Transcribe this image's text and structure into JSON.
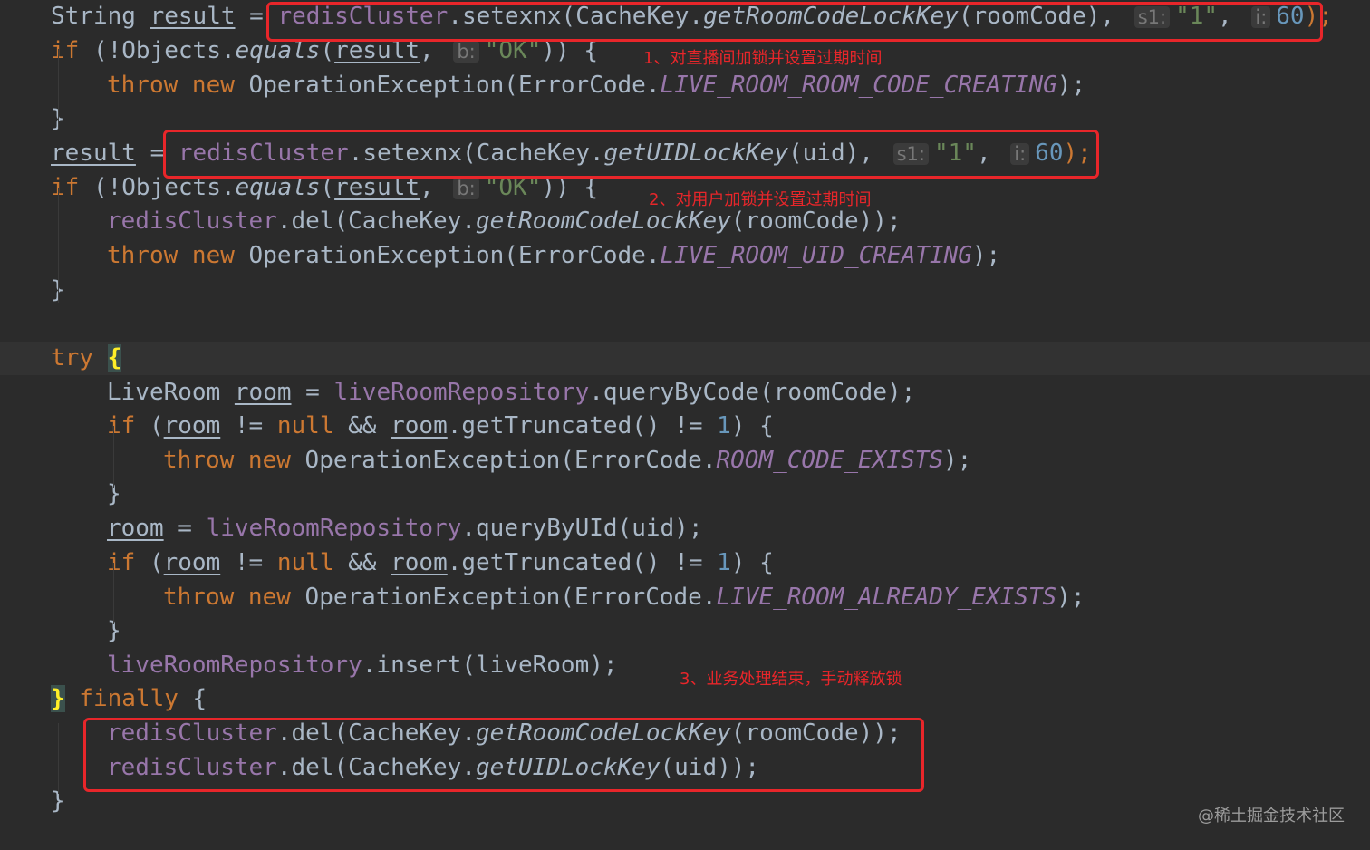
{
  "code": {
    "lines": [
      [
        [
          "String ",
          ""
        ],
        [
          "result",
          "var"
        ],
        [
          " = ",
          ""
        ],
        [
          "redisCluster",
          "fld"
        ],
        [
          ".setexnx(CacheKey.",
          ""
        ],
        [
          "getRoomCodeLockKey",
          "it"
        ],
        [
          "(roomCode), ",
          ""
        ],
        [
          "s1:",
          "hint"
        ],
        [
          "\"1\"",
          "str"
        ],
        [
          ", ",
          ""
        ],
        [
          "i:",
          "hint"
        ],
        [
          "60",
          "num"
        ],
        [
          ");",
          "kw"
        ]
      ],
      [
        [
          "if ",
          "kw"
        ],
        [
          "(!Objects.",
          ""
        ],
        [
          "equals",
          "it"
        ],
        [
          "(",
          ""
        ],
        [
          "result",
          "var"
        ],
        [
          ", ",
          ""
        ],
        [
          "b:",
          "hint"
        ],
        [
          "\"OK\"",
          "str"
        ],
        [
          ")) {",
          ""
        ]
      ],
      [
        [
          "throw new ",
          "kw"
        ],
        [
          "OperationException(ErrorCode.",
          ""
        ],
        [
          "LIVE_ROOM_ROOM_CODE_CREATING",
          "const"
        ],
        [
          ");",
          ""
        ]
      ],
      [
        [
          "}",
          ""
        ]
      ],
      [
        [
          "result",
          "var"
        ],
        [
          " = ",
          ""
        ],
        [
          "redisCluster",
          "fld"
        ],
        [
          ".setexnx(CacheKey.",
          ""
        ],
        [
          "getUIDLockKey",
          "it"
        ],
        [
          "(uid), ",
          ""
        ],
        [
          "s1:",
          "hint"
        ],
        [
          "\"1\"",
          "str"
        ],
        [
          ", ",
          ""
        ],
        [
          "i:",
          "hint"
        ],
        [
          "60",
          "num"
        ],
        [
          ");",
          "kw"
        ]
      ],
      [
        [
          "if ",
          "kw"
        ],
        [
          "(!Objects.",
          ""
        ],
        [
          "equals",
          "it"
        ],
        [
          "(",
          ""
        ],
        [
          "result",
          "var"
        ],
        [
          ", ",
          ""
        ],
        [
          "b:",
          "hint"
        ],
        [
          "\"OK\"",
          "str"
        ],
        [
          ")) {",
          ""
        ]
      ],
      [
        [
          "redisCluster",
          "fld"
        ],
        [
          ".del(CacheKey.",
          ""
        ],
        [
          "getRoomCodeLockKey",
          "it"
        ],
        [
          "(roomCode));",
          ""
        ]
      ],
      [
        [
          "throw new ",
          "kw"
        ],
        [
          "OperationException(ErrorCode.",
          ""
        ],
        [
          "LIVE_ROOM_UID_CREATING",
          "const"
        ],
        [
          ");",
          ""
        ]
      ],
      [
        [
          "}",
          ""
        ]
      ],
      [
        [
          "",
          ""
        ]
      ],
      [
        [
          "try ",
          "kw"
        ],
        [
          "{",
          "brace"
        ]
      ],
      [
        [
          "LiveRoom ",
          ""
        ],
        [
          "room",
          "var"
        ],
        [
          " = ",
          ""
        ],
        [
          "liveRoomRepository",
          "fld"
        ],
        [
          ".queryByCode(roomCode);",
          ""
        ]
      ],
      [
        [
          "if ",
          "kw"
        ],
        [
          "(",
          ""
        ],
        [
          "room",
          "var"
        ],
        [
          " != ",
          ""
        ],
        [
          "null",
          "kw"
        ],
        [
          " && ",
          ""
        ],
        [
          "room",
          "var"
        ],
        [
          ".getTruncated() != ",
          ""
        ],
        [
          "1",
          "num"
        ],
        [
          ") {",
          ""
        ]
      ],
      [
        [
          "throw new ",
          "kw"
        ],
        [
          "OperationException(ErrorCode.",
          ""
        ],
        [
          "ROOM_CODE_EXISTS",
          "const"
        ],
        [
          ");",
          ""
        ]
      ],
      [
        [
          "}",
          ""
        ]
      ],
      [
        [
          "room",
          "var"
        ],
        [
          " = ",
          ""
        ],
        [
          "liveRoomRepository",
          "fld"
        ],
        [
          ".queryByUId(uid);",
          ""
        ]
      ],
      [
        [
          "if ",
          "kw"
        ],
        [
          "(",
          ""
        ],
        [
          "room",
          "var"
        ],
        [
          " != ",
          ""
        ],
        [
          "null",
          "kw"
        ],
        [
          " && ",
          ""
        ],
        [
          "room",
          "var"
        ],
        [
          ".getTruncated() != ",
          ""
        ],
        [
          "1",
          "num"
        ],
        [
          ") {",
          ""
        ]
      ],
      [
        [
          "throw new ",
          "kw"
        ],
        [
          "OperationException(ErrorCode.",
          ""
        ],
        [
          "LIVE_ROOM_ALREADY_EXISTS",
          "const"
        ],
        [
          ");",
          ""
        ]
      ],
      [
        [
          "}",
          ""
        ]
      ],
      [
        [
          "liveRoomRepository",
          "fld"
        ],
        [
          ".insert(liveRoom);",
          ""
        ]
      ],
      [
        [
          "}",
          "brace"
        ],
        [
          " finally ",
          "kw"
        ],
        [
          "{",
          ""
        ]
      ],
      [
        [
          "redisCluster",
          "fld"
        ],
        [
          ".del(CacheKey.",
          ""
        ],
        [
          "getRoomCodeLockKey",
          "it"
        ],
        [
          "(roomCode));",
          ""
        ]
      ],
      [
        [
          "redisCluster",
          "fld"
        ],
        [
          ".del(CacheKey.",
          ""
        ],
        [
          "getUIDLockKey",
          "it"
        ],
        [
          "(uid));",
          ""
        ]
      ],
      [
        [
          "}",
          ""
        ]
      ]
    ]
  },
  "annotations": {
    "note1": "1、对直播间加锁并设置过期时间",
    "note2": "2、对用户加锁并设置过期时间",
    "note3": "3、业务处理结束，手动释放锁"
  },
  "watermark": "@稀土掘金技术社区",
  "colors": {
    "background": "#2b2b2b",
    "text": "#a9b7c6",
    "keyword": "#cc7832",
    "string": "#6a8759",
    "number": "#6897bb",
    "field": "#9876aa",
    "annotation": "#e8262a"
  }
}
